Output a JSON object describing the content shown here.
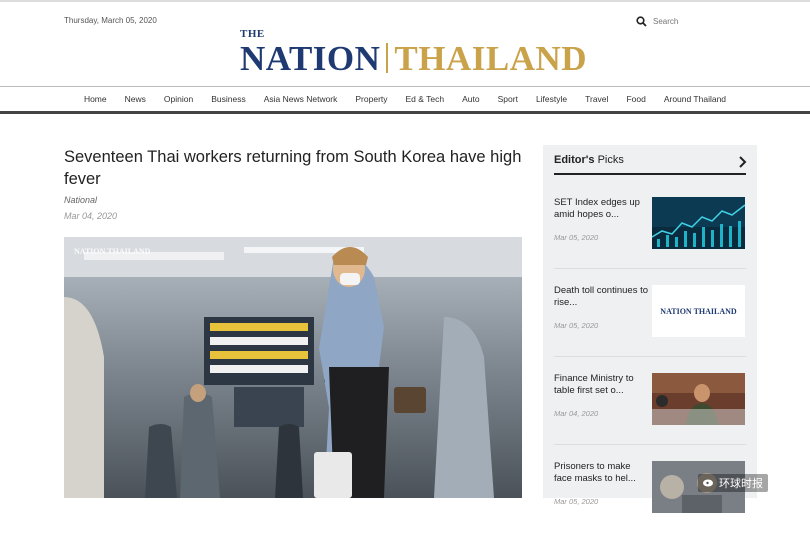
{
  "header": {
    "date": "Thursday, March 05, 2020",
    "search_placeholder": "Search",
    "logo": {
      "the": "THE",
      "nation": "NATION",
      "thailand": "THAILAND"
    }
  },
  "nav": [
    "Home",
    "News",
    "Opinion",
    "Business",
    "Asia News Network",
    "Property",
    "Ed & Tech",
    "Auto",
    "Sport",
    "Lifestyle",
    "Travel",
    "Food",
    "Around Thailand"
  ],
  "article": {
    "title": "Seventeen Thai workers returning from South Korea have high fever",
    "section": "National",
    "date": "Mar 04, 2020",
    "image_watermark": "NATION THAILAND"
  },
  "editors_picks": {
    "heading_bold": "Editor's",
    "heading_rest": "Picks",
    "items": [
      {
        "title": "SET Index edges up amid hopes o...",
        "date": "Mar 05, 2020",
        "thumb": "stock-chart"
      },
      {
        "title": "Death toll continues to rise...",
        "date": "Mar 05, 2020",
        "thumb": "nation-logo",
        "thumb_text": "NATION THAILAND"
      },
      {
        "title": "Finance Ministry to table first set o...",
        "date": "Mar 04, 2020",
        "thumb": "press-conference"
      },
      {
        "title": "Prisoners to make face masks to hel...",
        "date": "Mar 05, 2020",
        "thumb": "masks"
      }
    ]
  },
  "watermark": "环球时报",
  "colors": {
    "nation_blue": "#1f3a73",
    "thailand_gold": "#c9a24a",
    "sidebar_bg": "#eef0f2"
  }
}
